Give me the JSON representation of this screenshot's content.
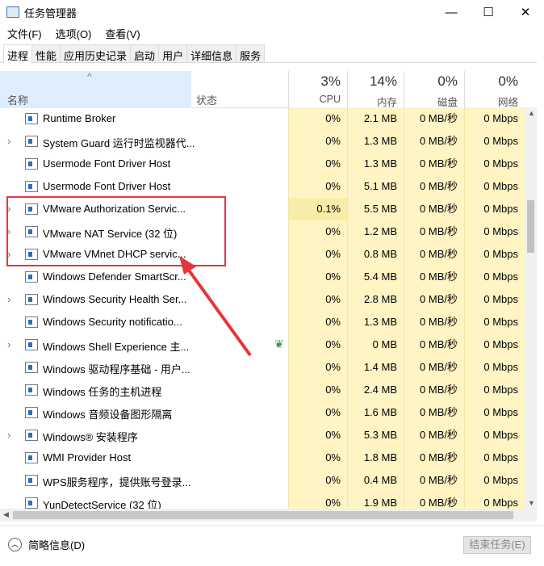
{
  "window": {
    "title": "任务管理器",
    "minimize": "—",
    "maximize": "☐",
    "close": "✕"
  },
  "menu": [
    "文件(F)",
    "选项(O)",
    "查看(V)"
  ],
  "tabs": [
    "进程",
    "性能",
    "应用历史记录",
    "启动",
    "用户",
    "详细信息",
    "服务"
  ],
  "header": {
    "name": "名称",
    "status": "状态",
    "cpu_pct": "3%",
    "cpu": "CPU",
    "mem_pct": "14%",
    "mem": "内存",
    "disk_pct": "0%",
    "disk": "磁盘",
    "net_pct": "0%",
    "net": "网络"
  },
  "rows": [
    {
      "name": "Runtime Broker",
      "cpu": "0%",
      "mem": "2.1 MB",
      "disk": "0 MB/秒",
      "net": "0 Mbps"
    },
    {
      "name": "System Guard 运行时监视器代...",
      "cpu": "0%",
      "mem": "1.3 MB",
      "disk": "0 MB/秒",
      "net": "0 Mbps"
    },
    {
      "name": "Usermode Font Driver Host",
      "cpu": "0%",
      "mem": "1.3 MB",
      "disk": "0 MB/秒",
      "net": "0 Mbps"
    },
    {
      "name": "Usermode Font Driver Host",
      "cpu": "0%",
      "mem": "5.1 MB",
      "disk": "0 MB/秒",
      "net": "0 Mbps"
    },
    {
      "name": "VMware Authorization Servic...",
      "cpu": "0.1%",
      "mem": "5.5 MB",
      "disk": "0 MB/秒",
      "net": "0 Mbps"
    },
    {
      "name": "VMware NAT Service (32 位)",
      "cpu": "0%",
      "mem": "1.2 MB",
      "disk": "0 MB/秒",
      "net": "0 Mbps"
    },
    {
      "name": "VMware VMnet DHCP servic...",
      "cpu": "0%",
      "mem": "0.8 MB",
      "disk": "0 MB/秒",
      "net": "0 Mbps"
    },
    {
      "name": "Windows Defender SmartScr...",
      "cpu": "0%",
      "mem": "5.4 MB",
      "disk": "0 MB/秒",
      "net": "0 Mbps"
    },
    {
      "name": "Windows Security Health Ser...",
      "cpu": "0%",
      "mem": "2.8 MB",
      "disk": "0 MB/秒",
      "net": "0 Mbps"
    },
    {
      "name": "Windows Security notificatio...",
      "cpu": "0%",
      "mem": "1.3 MB",
      "disk": "0 MB/秒",
      "net": "0 Mbps"
    },
    {
      "name": "Windows Shell Experience 主...",
      "cpu": "0%",
      "mem": "0 MB",
      "disk": "0 MB/秒",
      "net": "0 Mbps"
    },
    {
      "name": "Windows 驱动程序基础 - 用户...",
      "cpu": "0%",
      "mem": "1.4 MB",
      "disk": "0 MB/秒",
      "net": "0 Mbps"
    },
    {
      "name": "Windows 任务的主机进程",
      "cpu": "0%",
      "mem": "2.4 MB",
      "disk": "0 MB/秒",
      "net": "0 Mbps"
    },
    {
      "name": "Windows 音频设备图形隔离",
      "cpu": "0%",
      "mem": "1.6 MB",
      "disk": "0 MB/秒",
      "net": "0 Mbps"
    },
    {
      "name": "Windows® 安装程序",
      "cpu": "0%",
      "mem": "5.3 MB",
      "disk": "0 MB/秒",
      "net": "0 Mbps"
    },
    {
      "name": "WMI Provider Host",
      "cpu": "0%",
      "mem": "1.8 MB",
      "disk": "0 MB/秒",
      "net": "0 Mbps"
    },
    {
      "name": "WPS服务程序，提供账号登录...",
      "cpu": "0%",
      "mem": "0.4 MB",
      "disk": "0 MB/秒",
      "net": "0 Mbps"
    },
    {
      "name": "YunDetectService (32 位)",
      "cpu": "0%",
      "mem": "1.9 MB",
      "disk": "0 MB/秒",
      "net": "0 Mbps"
    }
  ],
  "footer": {
    "fewer_details": "简略信息(D)",
    "end_task": "结束任务(E)"
  }
}
